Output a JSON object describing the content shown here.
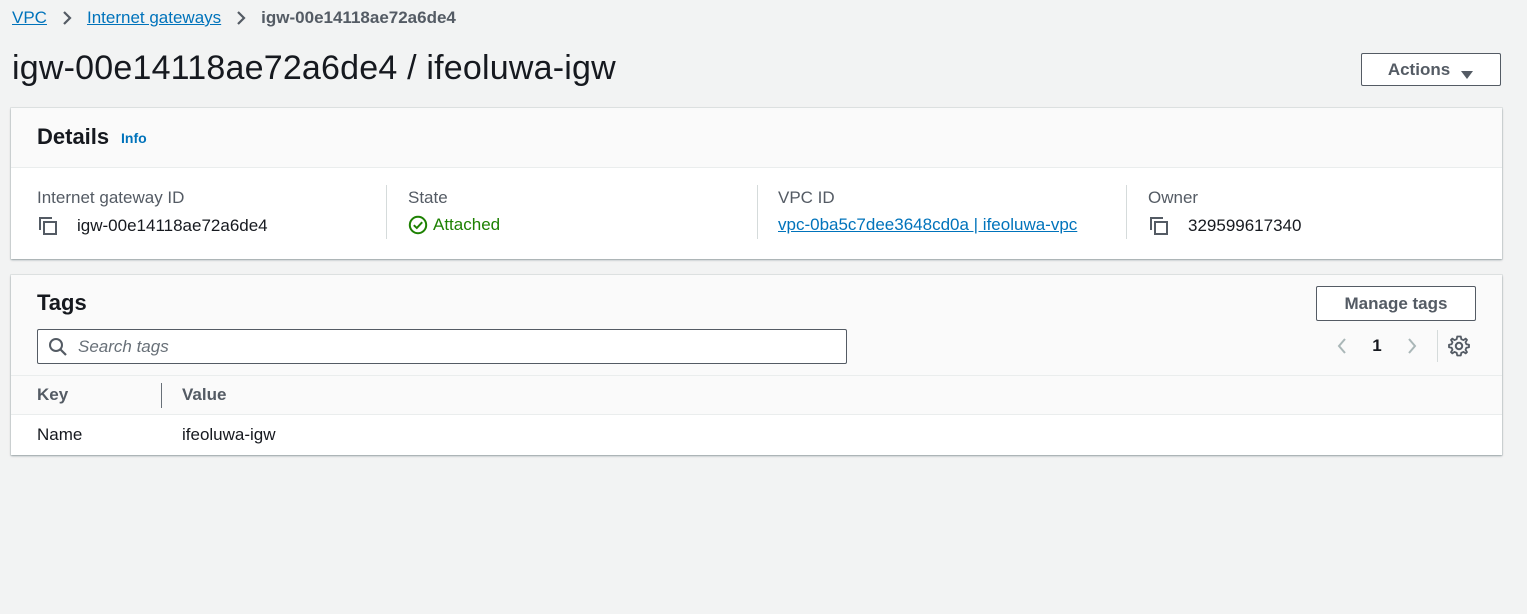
{
  "breadcrumb": {
    "items": [
      "VPC",
      "Internet gateways"
    ],
    "current": "igw-00e14118ae72a6de4"
  },
  "page": {
    "title": "igw-00e14118ae72a6de4 / ifeoluwa-igw",
    "actions_label": "Actions"
  },
  "details": {
    "title": "Details",
    "info_label": "Info",
    "fields": [
      {
        "label": "Internet gateway ID",
        "value": "igw-00e14118ae72a6de4"
      },
      {
        "label": "State",
        "value": "Attached"
      },
      {
        "label": "VPC ID",
        "value": "vpc-0ba5c7dee3648cd0a | ifeoluwa-vpc"
      },
      {
        "label": "Owner",
        "value": "329599617340"
      }
    ]
  },
  "tags": {
    "title": "Tags",
    "manage_label": "Manage tags",
    "search_placeholder": "Search tags",
    "page_number": "1",
    "columns": [
      "Key",
      "Value"
    ],
    "rows": [
      {
        "key": "Name",
        "value": "ifeoluwa-igw"
      }
    ]
  },
  "colors": {
    "link": "#0073bb",
    "success": "#1d8102",
    "text": "#16191f",
    "muted": "#545b64",
    "background": "#f2f3f3"
  },
  "icons": [
    "chevron-right-icon",
    "caret-down-icon",
    "copy-icon",
    "check-circle-icon",
    "search-icon",
    "chevron-left-icon",
    "gear-icon"
  ]
}
